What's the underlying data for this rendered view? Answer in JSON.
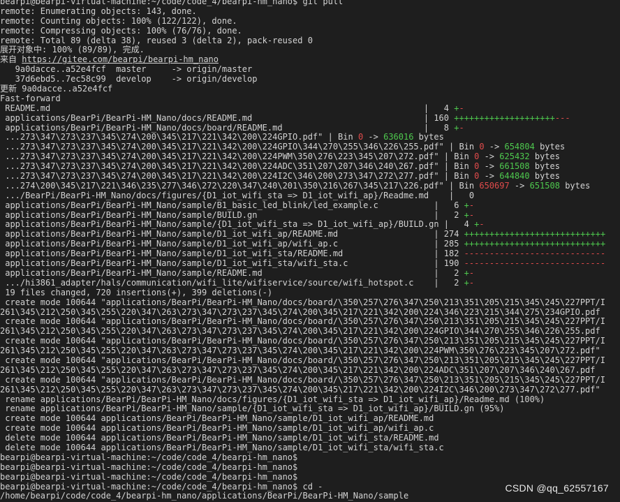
{
  "terminal": {
    "lines": [
      {
        "text": "bearpi@bearpi-virtual-machine:~/code/code_4/bearpi-hm_nano$ git pull"
      },
      {
        "text": "remote: Enumerating objects: 143, done."
      },
      {
        "text": "remote: Counting objects: 100% (122/122), done."
      },
      {
        "text": "remote: Compressing objects: 100% (76/76), done."
      },
      {
        "text": "remote: Total 89 (delta 38), reused 3 (delta 2), pack-reused 0"
      },
      {
        "text": "展开对象中: 100% (89/89), 完成."
      },
      {
        "text": "来自 https://gitee.com/bearpi/bearpi-hm_nano"
      },
      {
        "text": "   9a0dacce..a52e4fcf  master     -> origin/master"
      },
      {
        "text": "   37d6ebd5..7ec58c99  develop    -> origin/develop"
      },
      {
        "text": "更新 9a0dacce..a52e4fcf"
      },
      {
        "text": "Fast-forward"
      },
      {
        "text": " README.md                                                                          |   4 ",
        "suffix": "+-",
        "suffix_type": "diffstat"
      },
      {
        "text": " applications/BearPi/BearPi-HM_Nano/docs/README.md                                  | 160 ",
        "suffix": "++++++++++++++++++++---",
        "suffix_type": "diffstat"
      },
      {
        "text": " applications/BearPi/BearPi-HM_Nano/docs/board/README.md                            |   8 ",
        "suffix": "+-",
        "suffix_type": "diffstat"
      },
      {
        "text": " ...273\\347\\273\\237\\345\\274\\200\\345\\217\\221\\342\\200\\224GPIO.pdf\" | Bin ",
        "suffix": "0 -> 636016 bytes",
        "suffix_type": "bin",
        "old": "0",
        "new": "636016"
      },
      {
        "text": " ...273\\347\\273\\237\\345\\274\\200\\345\\217\\221\\342\\200\\224GPIO\\344\\270\\255\\346\\226\\255.pdf\" | Bin ",
        "suffix": "0 -> 654804 bytes",
        "suffix_type": "bin",
        "old": "0",
        "new": "654804"
      },
      {
        "text": " ...273\\347\\273\\237\\345\\274\\200\\345\\217\\221\\342\\200\\224PWM\\350\\276\\223\\345\\207\\272.pdf\" | Bin ",
        "suffix": "0 -> 625432 bytes",
        "suffix_type": "bin",
        "old": "0",
        "new": "625432"
      },
      {
        "text": " ...273\\347\\273\\237\\345\\274\\200\\345\\217\\221\\342\\200\\224ADC\\351\\207\\207\\346\\240\\267.pdf\" | Bin ",
        "suffix": "0 -> 661508 bytes",
        "suffix_type": "bin",
        "old": "0",
        "new": "661508"
      },
      {
        "text": " ...273\\347\\273\\237\\345\\274\\200\\345\\217\\221\\342\\200\\224I2C\\346\\200\\273\\347\\272\\277.pdf\" | Bin ",
        "suffix": "0 -> 644840 bytes",
        "suffix_type": "bin",
        "old": "0",
        "new": "644840"
      },
      {
        "text": " ...274\\200\\345\\217\\221\\346\\235\\277\\346\\272\\220\\347\\240\\201\\350\\216\\267\\345\\217\\226.pdf\" | Bin ",
        "suffix": "650697 -> 651508 bytes",
        "suffix_type": "bin",
        "old": "650697",
        "new": "651508"
      },
      {
        "text": " .../BearPi/BearPi-HM_Nano/docs/figures/{D1_iot_wifi_sta => D1_iot_wifi_ap}/Readme.md    |   0"
      },
      {
        "text": " applications/BearPi/BearPi-HM_Nano/sample/B1_basic_led_blink/led_example.c           |   6 ",
        "suffix": "+-",
        "suffix_type": "diffstat"
      },
      {
        "text": " applications/BearPi/BearPi-HM_Nano/sample/BUILD.gn                                   |   2 ",
        "suffix": "+-",
        "suffix_type": "diffstat"
      },
      {
        "text": " applications/BearPi/BearPi-HM_Nano/sample/{D1_iot_wifi_sta => D1_iot_wifi_ap}/BUILD.gn |   4 ",
        "suffix": "+-",
        "suffix_type": "diffstat"
      },
      {
        "text": " applications/BearPi/BearPi-HM_Nano/sample/D1_iot_wifi_ap/README.md                   | 274 ",
        "suffix": "++++++++++++++++++++++++++++",
        "suffix_type": "diffstat"
      },
      {
        "text": " applications/BearPi/BearPi-HM_Nano/sample/D1_iot_wifi_ap/wifi_ap.c                   | 285 ",
        "suffix": "++++++++++++++++++++++++++++",
        "suffix_type": "diffstat"
      },
      {
        "text": " applications/BearPi/BearPi-HM_Nano/sample/D1_iot_wifi_sta/README.md                  | 182 ",
        "suffix": "----------------------------",
        "suffix_type": "diffstat"
      },
      {
        "text": " applications/BearPi/BearPi-HM_Nano/sample/D1_iot_wifi_sta/wifi_sta.c                 | 190 ",
        "suffix": "----------------------------",
        "suffix_type": "diffstat"
      },
      {
        "text": " applications/BearPi/BearPi-HM_Nano/sample/README.md                                  |   2 ",
        "suffix": "+-",
        "suffix_type": "diffstat"
      },
      {
        "text": " .../hi3861_adapter/hals/communication/wifi_lite/wifiservice/source/wifi_hotspot.c    |   2 ",
        "suffix": "+-",
        "suffix_type": "diffstat"
      },
      {
        "text": " 19 files changed, 720 insertions(+), 399 deletions(-)"
      },
      {
        "text": " create mode 100644 \"applications/BearPi/BearPi-HM_Nano/docs/board/\\350\\257\\276\\347\\250\\213\\351\\205\\215\\345\\245\\227PPT/I"
      },
      {
        "text": "261\\345\\212\\250\\345\\255\\220\\347\\263\\273\\347\\273\\237\\345\\274\\200\\345\\217\\221\\342\\200\\224\\346\\223\\215\\344\\275\\234GPIO.pdf"
      },
      {
        "text": " create mode 100644 \"applications/BearPi/BearPi-HM_Nano/docs/board/\\350\\257\\276\\347\\250\\213\\351\\205\\215\\345\\245\\227PPT/I"
      },
      {
        "text": "261\\345\\212\\250\\345\\255\\220\\347\\263\\273\\347\\273\\237\\345\\274\\200\\345\\217\\221\\342\\200\\224GPIO\\344\\270\\255\\346\\226\\255.pdf"
      },
      {
        "text": " create mode 100644 \"applications/BearPi/BearPi-HM_Nano/docs/board/\\350\\257\\276\\347\\250\\213\\351\\205\\215\\345\\245\\227PPT/I"
      },
      {
        "text": "261\\345\\212\\250\\345\\255\\220\\347\\263\\273\\347\\273\\237\\345\\274\\200\\345\\217\\221\\342\\200\\224PWM\\350\\276\\223\\345\\207\\272.pdf\""
      },
      {
        "text": " create mode 100644 \"applications/BearPi/BearPi-HM_Nano/docs/board/\\350\\257\\276\\347\\250\\213\\351\\205\\215\\345\\245\\227PPT/I"
      },
      {
        "text": "261\\345\\212\\250\\345\\255\\220\\347\\263\\273\\347\\273\\237\\345\\274\\200\\345\\217\\221\\342\\200\\224ADC\\351\\207\\207\\346\\240\\267.pdf"
      },
      {
        "text": " create mode 100644 \"applications/BearPi/BearPi-HM_Nano/docs/board/\\350\\257\\276\\347\\250\\213\\351\\205\\215\\345\\245\\227PPT/I"
      },
      {
        "text": "261\\345\\212\\250\\345\\255\\220\\347\\263\\273\\347\\273\\237\\345\\274\\200\\345\\217\\221\\342\\200\\224I2C\\346\\200\\273\\347\\272\\277.pdf\""
      },
      {
        "text": " rename applications/BearPi/BearPi-HM_Nano/docs/figures/{D1_iot_wifi_sta => D1_iot_wifi_ap}/Readme.md (100%)"
      },
      {
        "text": " rename applications/BearPi/BearPi-HM_Nano/sample/{D1_iot_wifi_sta => D1_iot_wifi_ap}/BUILD.gn (95%)"
      },
      {
        "text": " create mode 100644 applications/BearPi/BearPi-HM_Nano/sample/D1_iot_wifi_ap/README.md"
      },
      {
        "text": " create mode 100644 applications/BearPi/BearPi-HM_Nano/sample/D1_iot_wifi_ap/wifi_ap.c"
      },
      {
        "text": " delete mode 100644 applications/BearPi/BearPi-HM_Nano/sample/D1_iot_wifi_sta/README.md"
      },
      {
        "text": " delete mode 100644 applications/BearPi/BearPi-HM_Nano/sample/D1_iot_wifi_sta/wifi_sta.c"
      },
      {
        "text": "bearpi@bearpi-virtual-machine:~/code/code_4/bearpi-hm_nano$"
      },
      {
        "text": "bearpi@bearpi-virtual-machine:~/code/code_4/bearpi-hm_nano$"
      },
      {
        "text": "bearpi@bearpi-virtual-machine:~/code/code_4/bearpi-hm_nano$"
      },
      {
        "text": "bearpi@bearpi-virtual-machine:~/code/code_4/bearpi-hm_nano$ cd -"
      },
      {
        "text": "/home/bearpi/code/code_4/bearpi-hm_nano/applications/BearPi/BearPi-HM_Nano/sample"
      }
    ],
    "watermark": "CSDN @qq_62557167",
    "colors": {
      "background": "#1e1e1e",
      "text": "#d3d3d3",
      "plus": "#4ec94e",
      "minus": "#e04b4b"
    }
  }
}
